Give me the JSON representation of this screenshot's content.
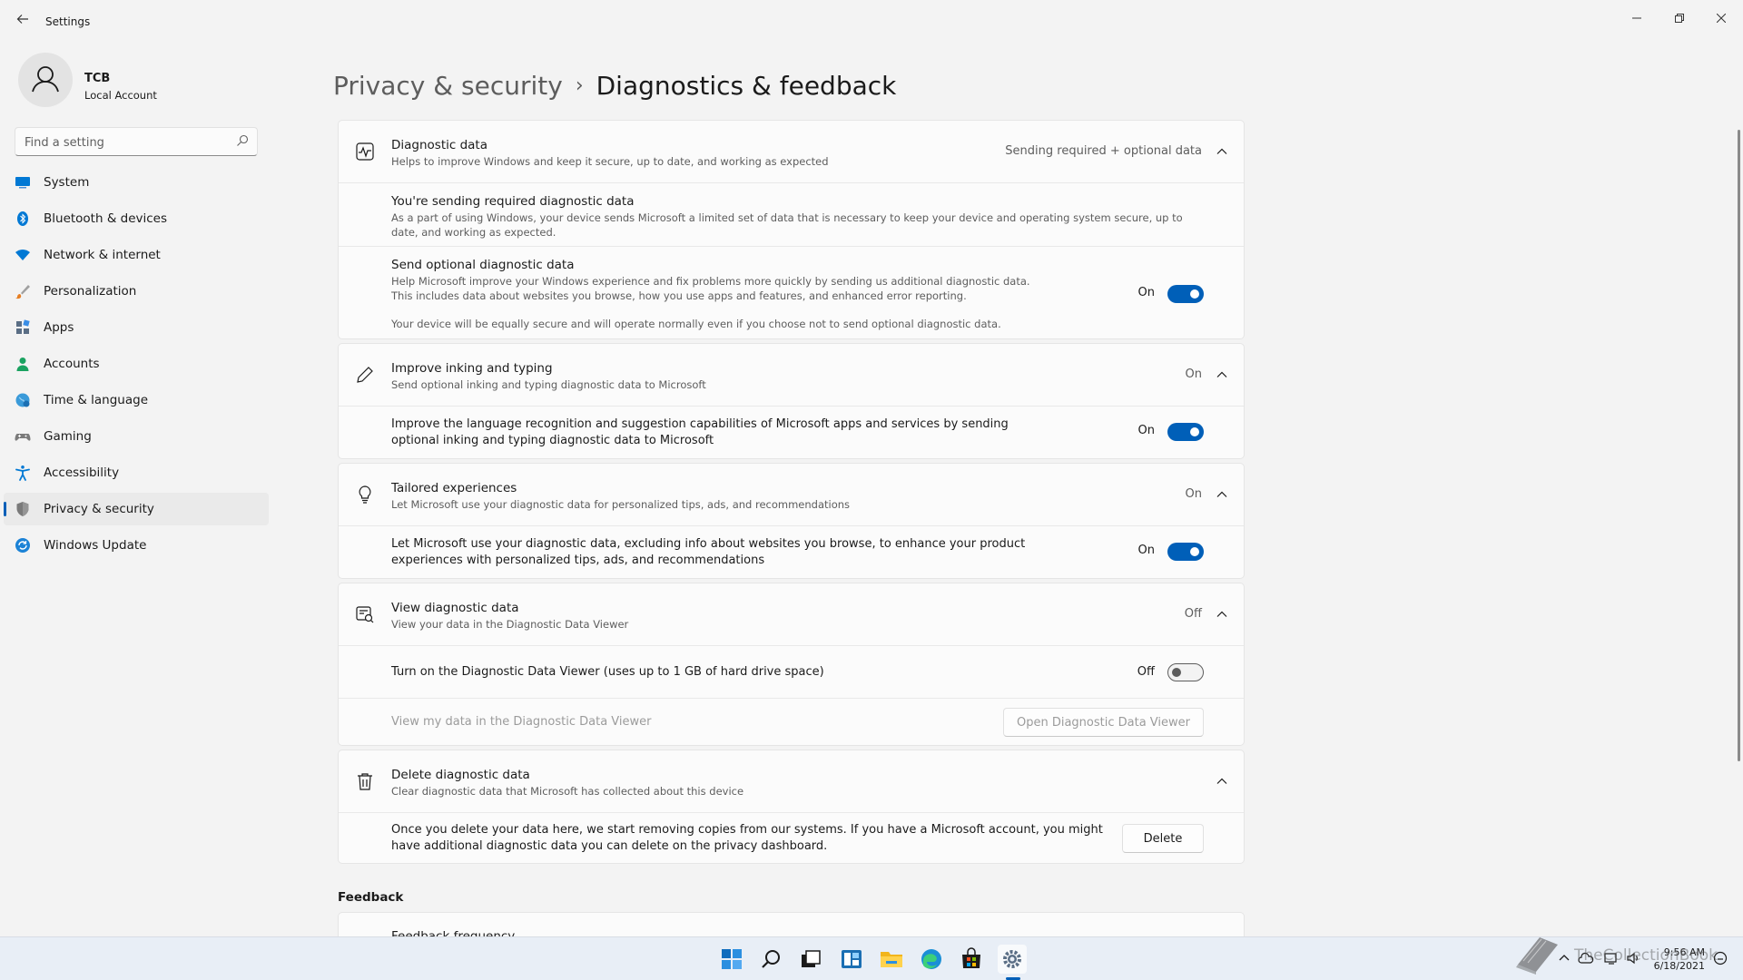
{
  "window": {
    "app_title": "Settings"
  },
  "profile": {
    "name": "TCB",
    "account_type": "Local Account"
  },
  "search": {
    "placeholder": "Find a setting"
  },
  "nav": {
    "items": [
      {
        "label": "System",
        "icon": "system-icon",
        "color": "#0078d4"
      },
      {
        "label": "Bluetooth & devices",
        "icon": "bluetooth-icon",
        "color": "#0078d4"
      },
      {
        "label": "Network & internet",
        "icon": "wifi-icon",
        "color": "#0078d4"
      },
      {
        "label": "Personalization",
        "icon": "brush-icon",
        "color": "#e67e22"
      },
      {
        "label": "Apps",
        "icon": "apps-icon",
        "color": "#5a6e85"
      },
      {
        "label": "Accounts",
        "icon": "person-icon",
        "color": "#1aa260"
      },
      {
        "label": "Time & language",
        "icon": "globe-clock-icon",
        "color": "#0078d4"
      },
      {
        "label": "Gaming",
        "icon": "gamepad-icon",
        "color": "#7a7a7a"
      },
      {
        "label": "Accessibility",
        "icon": "accessibility-icon",
        "color": "#0078d4"
      },
      {
        "label": "Privacy & security",
        "icon": "shield-icon",
        "color": "#7a7a7a"
      },
      {
        "label": "Windows Update",
        "icon": "update-icon",
        "color": "#0078d4"
      }
    ],
    "active_index": 9
  },
  "breadcrumb": {
    "parent": "Privacy & security",
    "separator": "›",
    "current": "Diagnostics & feedback"
  },
  "diagnostic_data": {
    "title": "Diagnostic data",
    "description": "Helps to improve Windows and keep it secure, up to date, and working as expected",
    "value": "Sending required + optional data",
    "required": {
      "title": "You're sending required diagnostic data",
      "description": "As a part of using Windows, your device sends Microsoft a limited set of data that is necessary to keep your device and operating system secure, up to date, and working as expected."
    },
    "optional": {
      "title": "Send optional diagnostic data",
      "description": "Help Microsoft improve your Windows experience and fix problems more quickly by sending us additional diagnostic data. This includes data about websites you browse, how you use apps and features, and enhanced error reporting.",
      "note": "Your device will be equally secure and will operate normally even if you choose not to send optional diagnostic data.",
      "state_label": "On",
      "on": true
    }
  },
  "inking": {
    "title": "Improve inking and typing",
    "description": "Send optional inking and typing diagnostic data to Microsoft",
    "value": "On",
    "detail": "Improve the language recognition and suggestion capabilities of Microsoft apps and services by sending optional inking and typing diagnostic data to Microsoft",
    "state_label": "On",
    "on": true
  },
  "tailored": {
    "title": "Tailored experiences",
    "description": "Let Microsoft use your diagnostic data for personalized tips, ads, and recommendations",
    "value": "On",
    "detail": "Let Microsoft use your diagnostic data, excluding info about websites you browse, to enhance your product experiences with personalized tips, ads, and recommendations",
    "state_label": "On",
    "on": true
  },
  "viewer": {
    "title": "View diagnostic data",
    "description": "View your data in the Diagnostic Data Viewer",
    "value": "Off",
    "toggle_text": "Turn on the Diagnostic Data Viewer (uses up to 1 GB of hard drive space)",
    "state_label": "Off",
    "on": false,
    "open_text": "View my data in the Diagnostic Data Viewer",
    "open_button": "Open Diagnostic Data Viewer"
  },
  "delete": {
    "title": "Delete diagnostic data",
    "description": "Clear diagnostic data that Microsoft has collected about this device",
    "detail": "Once you delete your data here, we start removing copies from our systems. If you have a Microsoft account, you might have additional diagnostic data you can delete on the privacy dashboard.",
    "button": "Delete"
  },
  "feedback": {
    "section_title": "Feedback",
    "frequency_title": "Feedback frequency"
  },
  "taskbar": {
    "apps": [
      "start-icon",
      "search-icon",
      "task-view-icon",
      "widgets-icon",
      "file-explorer-icon",
      "edge-icon",
      "store-icon",
      "settings-icon"
    ],
    "time": "9:56 AM",
    "date": "6/18/2021"
  },
  "watermark": {
    "text": "TheCollectionBook"
  },
  "colors": {
    "accent": "#005fb8",
    "background": "#f3f3f3",
    "card": "#fbfbfb"
  }
}
